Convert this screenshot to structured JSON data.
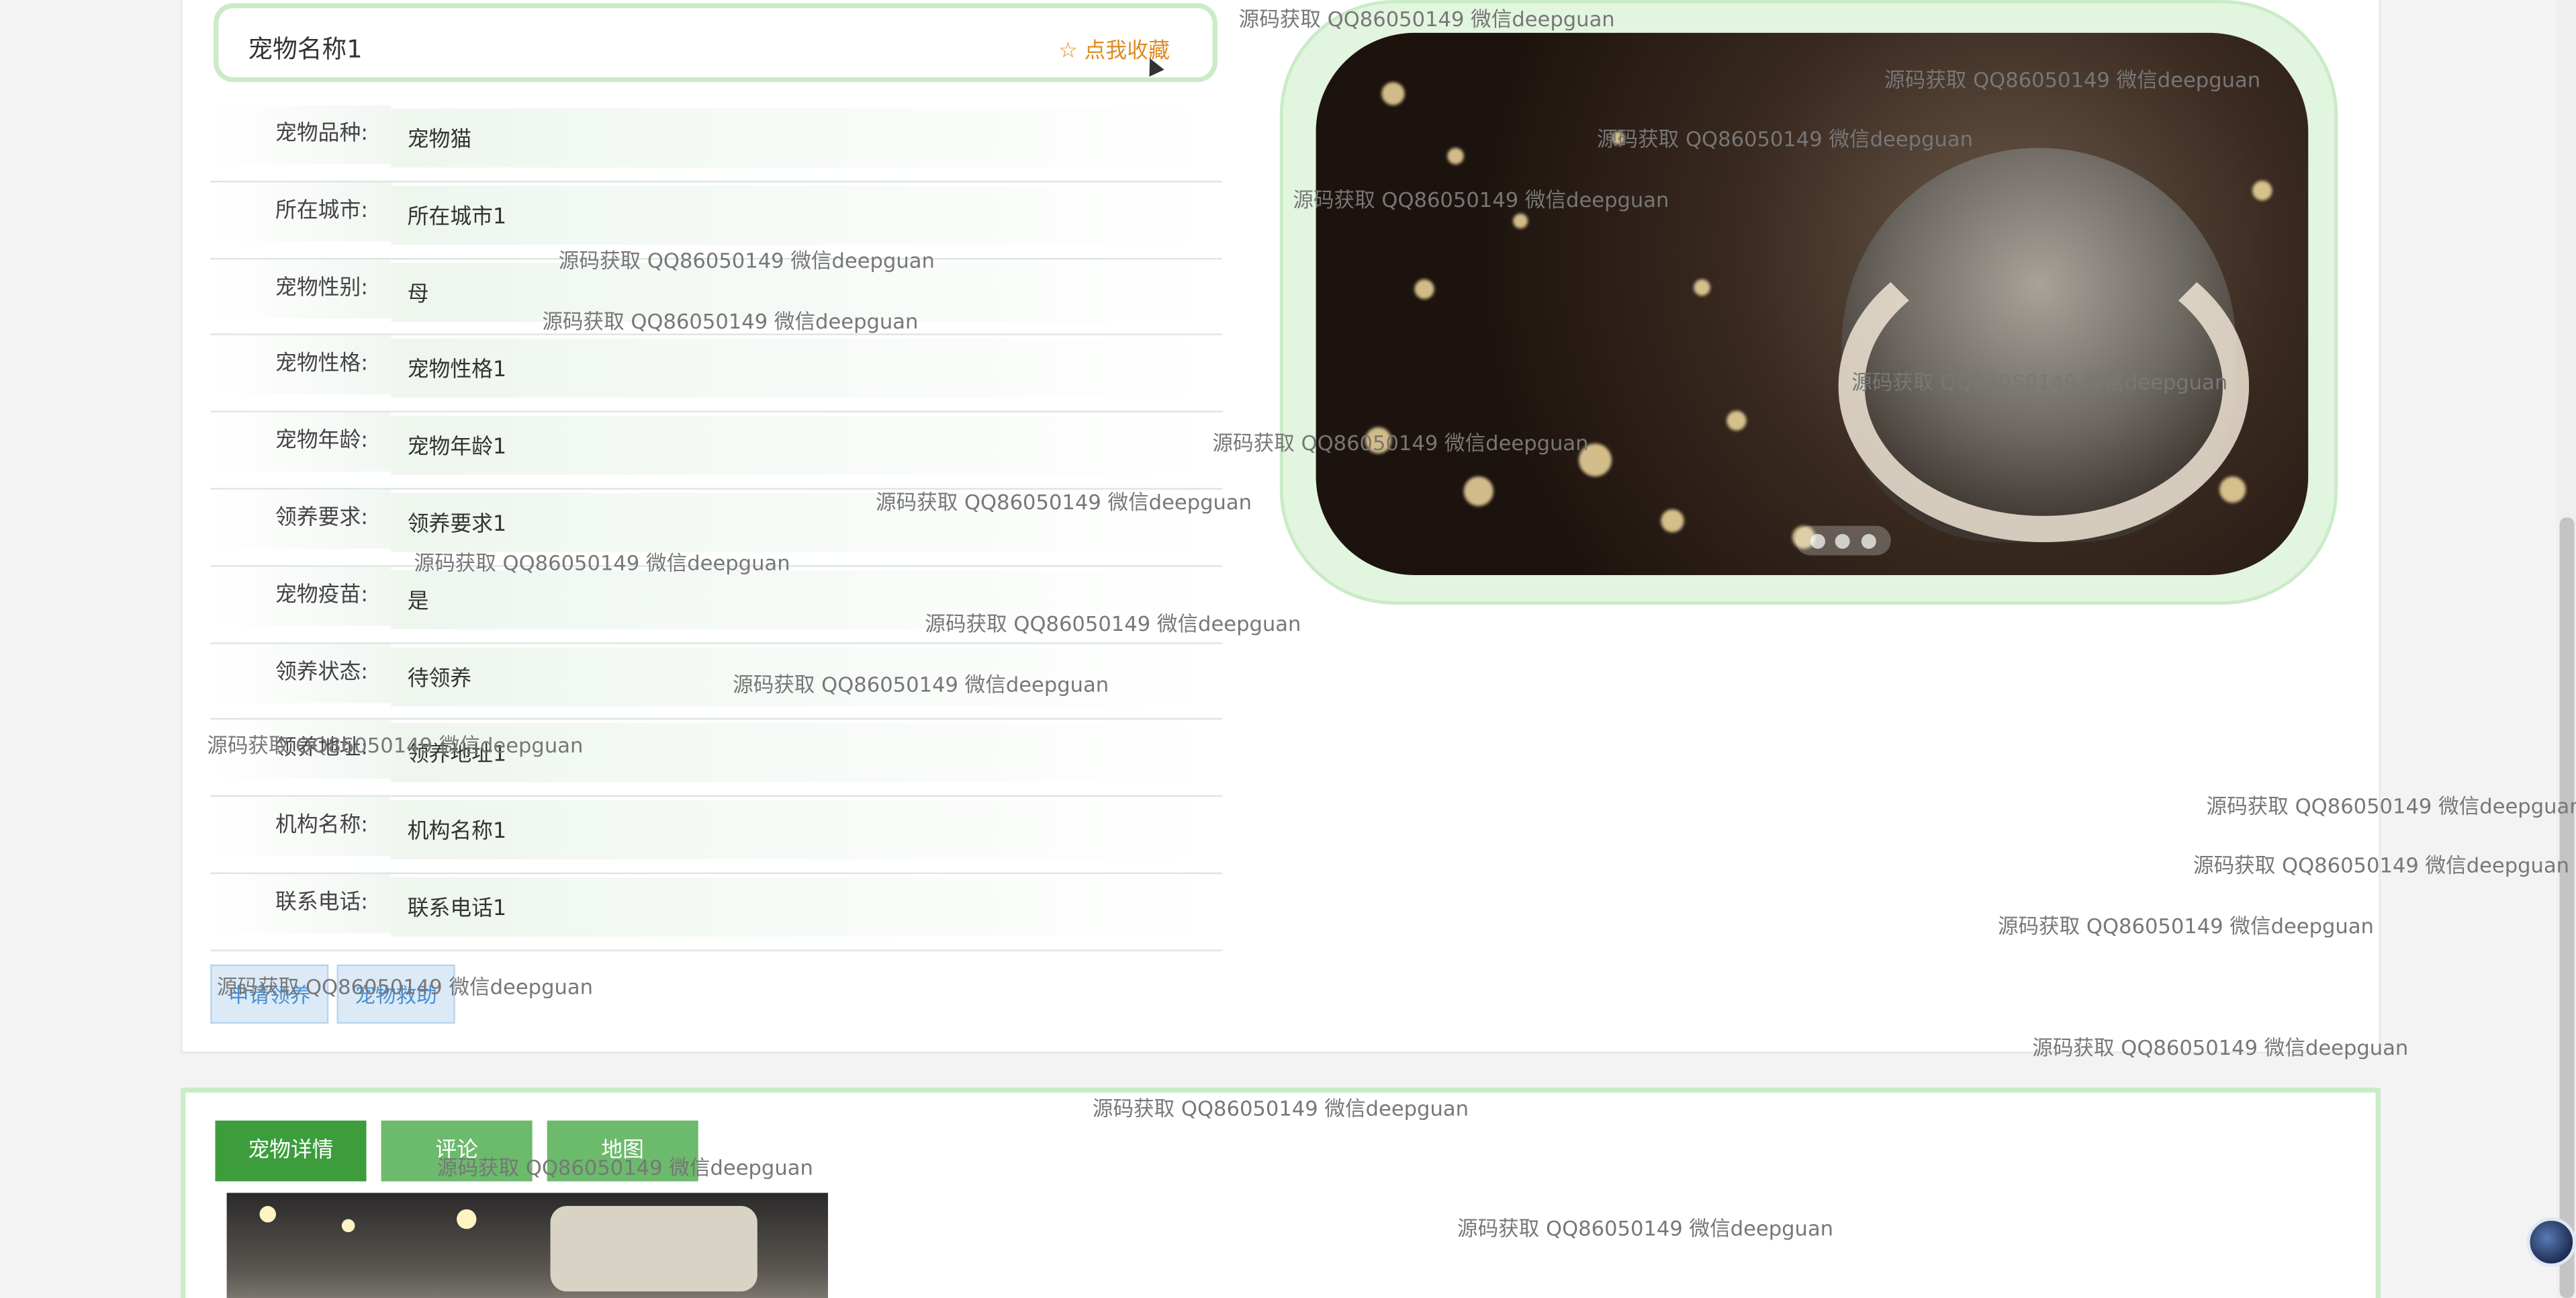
{
  "pet": {
    "name": "宠物名称1",
    "favorite_label": "点我收藏",
    "favorite_icon": "star-outline-icon"
  },
  "details": [
    {
      "label": "宠物品种:",
      "value": "宠物猫"
    },
    {
      "label": "所在城市:",
      "value": "所在城市1"
    },
    {
      "label": "宠物性别:",
      "value": "母"
    },
    {
      "label": "宠物性格:",
      "value": "宠物性格1"
    },
    {
      "label": "宠物年龄:",
      "value": "宠物年龄1"
    },
    {
      "label": "领养要求:",
      "value": "领养要求1"
    },
    {
      "label": "宠物疫苗:",
      "value": "是"
    },
    {
      "label": "领养状态:",
      "value": "待领养"
    },
    {
      "label": "领养地址:",
      "value": "领养地址1"
    },
    {
      "label": "机构名称:",
      "value": "机构名称1"
    },
    {
      "label": "联系电话:",
      "value": "联系电话1"
    }
  ],
  "actions": {
    "adopt_label": "申请领养",
    "rescue_label": "宠物救助"
  },
  "tabs": [
    {
      "label": "宠物详情",
      "active": true
    },
    {
      "label": "评论",
      "active": false
    },
    {
      "label": "地图",
      "active": false
    }
  ],
  "watermark": "源码获取 QQ86050149 微信deepguan",
  "colors": {
    "accent_green": "#3d9d3d",
    "frame_green": "#c9ecc6",
    "favorite_orange": "#e08a1e",
    "button_blue": "#4a8fd1"
  }
}
